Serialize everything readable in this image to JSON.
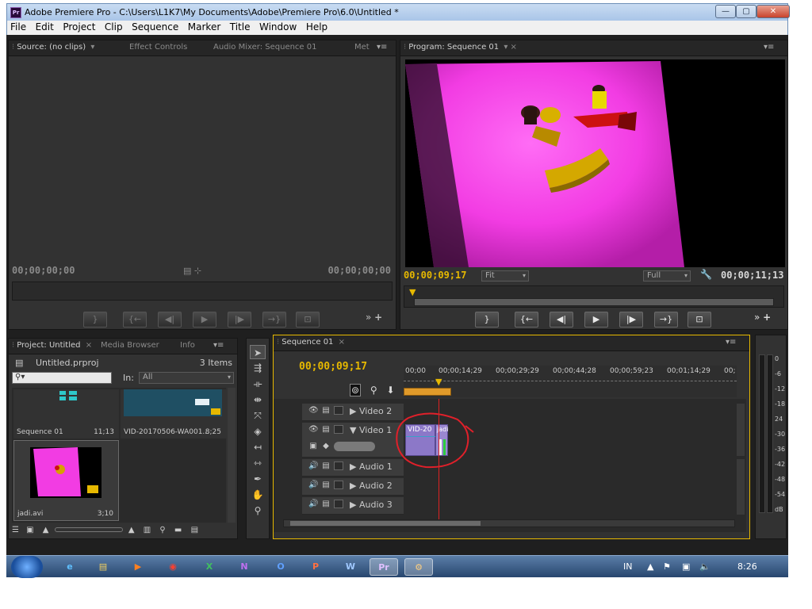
{
  "window": {
    "app_icon_text": "Pr",
    "title": "Adobe Premiere Pro - C:\\Users\\L1K7\\My Documents\\Adobe\\Premiere Pro\\6.0\\Untitled *",
    "minimize": "—",
    "maximize": "▢",
    "close": "✕"
  },
  "menu": [
    "File",
    "Edit",
    "Project",
    "Clip",
    "Sequence",
    "Marker",
    "Title",
    "Window",
    "Help"
  ],
  "source_panel": {
    "tabs": [
      "Source: (no clips)",
      "Effect Controls",
      "Audio Mixer: Sequence 01",
      "Met"
    ],
    "timecode_left": "00;00;00;00",
    "timecode_right": "00;00;00;00"
  },
  "program_panel": {
    "tab": "Program: Sequence 01",
    "timecode_current": "00;00;09;17",
    "zoom": "Fit",
    "quality": "Full",
    "timecode_duration": "00;00;11;13",
    "controls": [
      "}",
      "{←",
      "◀|",
      "▶",
      "|▶",
      "→}",
      "⊡"
    ]
  },
  "project_panel": {
    "tabs": [
      "Project: Untitled",
      "Media Browser",
      "Info"
    ],
    "file_name": "Untitled.prproj",
    "item_count": "3 Items",
    "in_label": "In:",
    "in_value": "All",
    "items": [
      {
        "name": "Sequence 01",
        "duration": "11;13"
      },
      {
        "name": "VID-20170506-WA001...",
        "duration": "8;25"
      },
      {
        "name": "jadi.avi",
        "duration": "3;10"
      }
    ]
  },
  "timeline": {
    "tab": "Sequence 01",
    "timecode": "00;00;09;17",
    "ruler_labels": [
      "00;00",
      "00;00;14;29",
      "00;00;29;29",
      "00;00;44;28",
      "00;00;59;23",
      "00;01;14;29",
      "00;"
    ],
    "video_tracks": [
      "Video 2",
      "Video 1"
    ],
    "audio_tracks": [
      "Audio 1",
      "Audio 2",
      "Audio 3"
    ],
    "clip_label": "VID-20",
    "clip_label_2": "jadi"
  },
  "audio_meter": {
    "labels": [
      "0",
      "-6",
      "-12",
      "-18",
      "24",
      "-30",
      "-36",
      "-42",
      "-48",
      "-54",
      "dB"
    ]
  },
  "taskbar": {
    "apps": [
      "e",
      "▤",
      "▶",
      "◉",
      "X",
      "N",
      "O",
      "P",
      "W",
      "Pr",
      "⚙"
    ],
    "lang": "IN",
    "clock": "8:26"
  },
  "colors": {
    "accent_yellow": "#e6b800",
    "annotation_red": "#e0202a",
    "clip_purple": "#8c78c8",
    "magenta": "#ff3df0"
  }
}
